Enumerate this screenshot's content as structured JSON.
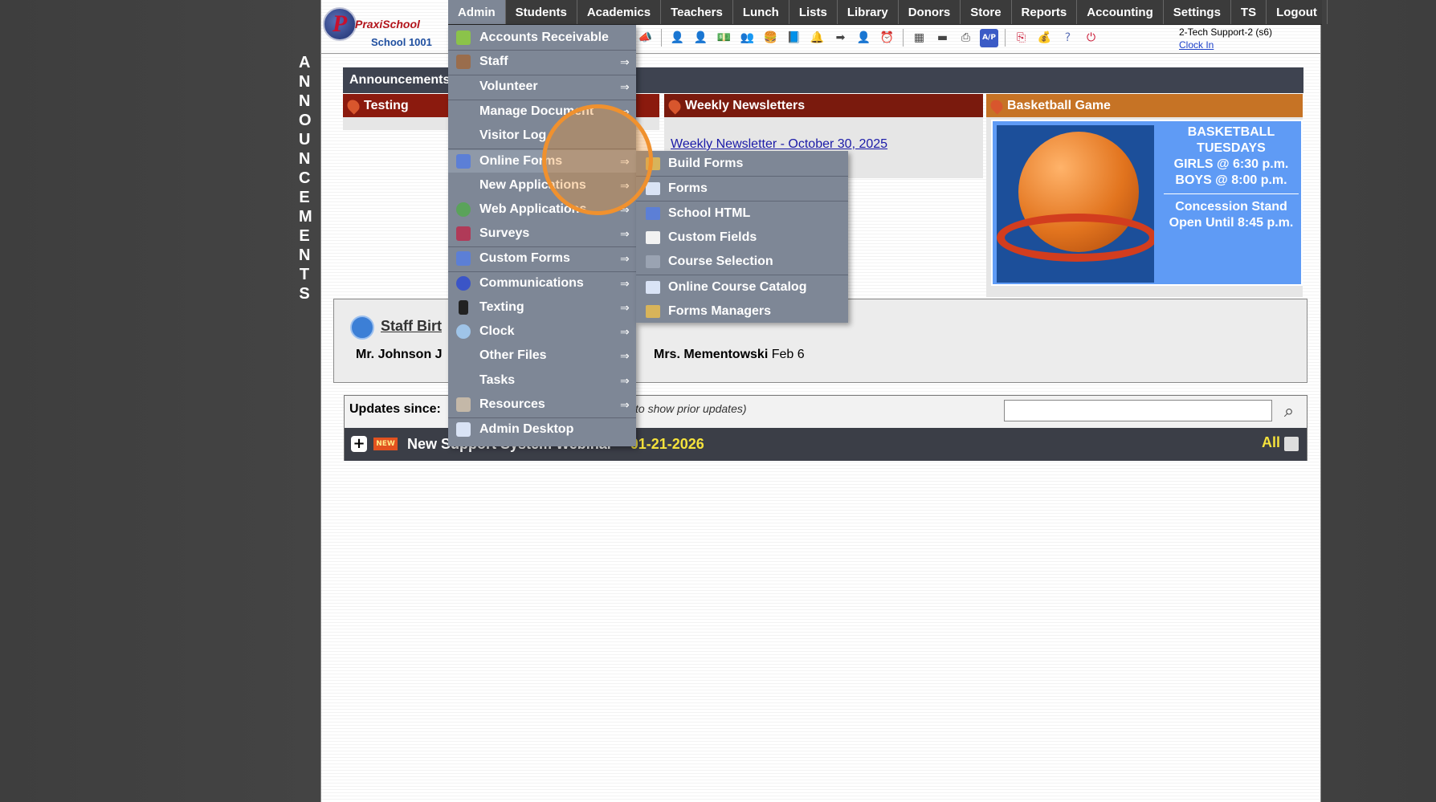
{
  "side_label": [
    "A",
    "N",
    "N",
    "O",
    "U",
    "N",
    "C",
    "E",
    "M",
    "E",
    "N",
    "T",
    "S"
  ],
  "logo": {
    "brand": "PraxiSchool",
    "school": "School 1001"
  },
  "nav": {
    "items": [
      "Admin",
      "Students",
      "Academics",
      "Teachers",
      "Lunch",
      "Lists",
      "Library",
      "Donors",
      "Store",
      "Reports",
      "Accounting",
      "Settings",
      "TS",
      "Logout"
    ],
    "active": "Admin"
  },
  "user": {
    "name": "2-Tech Support-2 (s6)",
    "clock_in": "Clock In"
  },
  "announcements": {
    "title": "Announcements",
    "cards": [
      {
        "title": "Testing"
      },
      {
        "title": "Weekly Newsletters",
        "link": "Weekly Newsletter - October 30, 2025"
      },
      {
        "title": "Basketball Game"
      }
    ],
    "basketball": {
      "line1": "BASKETBALL",
      "line2": "TUESDAYS",
      "line3": "GIRLS @ 6:30 p.m.",
      "line4": "BOYS  @ 8:00 p.m.",
      "line5": "Concession Stand",
      "line6": "Open Until 8:45 p.m."
    }
  },
  "birthdays": {
    "title": "Staff Birt",
    "entry1": "Mr. Johnson J",
    "entry2_name": "Mrs. Mementowski",
    "entry2_date": "Feb 6"
  },
  "updates": {
    "label": "Updates since:",
    "hint": "to show prior updates)",
    "search_placeholder": "",
    "badge": "NEW",
    "headline": "New Support System Webinar --",
    "date": "01-21-2026",
    "all": "All"
  },
  "admin_menu": {
    "items": [
      {
        "label": "Accounts Receivable",
        "arrow": "",
        "icon": "money-icon"
      },
      {
        "label": "Staff",
        "arrow": "⇒",
        "icon": "staff-icon"
      },
      {
        "label": "Volunteer",
        "arrow": "⇒",
        "icon": ""
      },
      {
        "label": "Manage Document",
        "arrow": "⇒",
        "icon": ""
      },
      {
        "label": "Visitor Log",
        "arrow": "",
        "icon": ""
      },
      {
        "label": "Online Forms",
        "arrow": "⇒",
        "icon": "html-icon"
      },
      {
        "label": "New Applications",
        "arrow": "⇒",
        "icon": ""
      },
      {
        "label": "Web Applications",
        "arrow": "⇒",
        "icon": "globe-icon"
      },
      {
        "label": "Surveys",
        "arrow": "⇒",
        "icon": "survey-icon"
      },
      {
        "label": "Custom Forms",
        "arrow": "⇒",
        "icon": "html-icon"
      },
      {
        "label": "Communications",
        "arrow": "⇒",
        "icon": "at-icon"
      },
      {
        "label": "Texting",
        "arrow": "⇒",
        "icon": "phone-icon"
      },
      {
        "label": "Clock",
        "arrow": "⇒",
        "icon": "clock-icon"
      },
      {
        "label": "Other Files",
        "arrow": "⇒",
        "icon": ""
      },
      {
        "label": "Tasks",
        "arrow": "⇒",
        "icon": ""
      },
      {
        "label": "Resources",
        "arrow": "⇒",
        "icon": "resources-icon"
      },
      {
        "label": "Admin Desktop",
        "arrow": "",
        "icon": "desktop-icon"
      }
    ]
  },
  "online_forms_submenu": {
    "items": [
      "Build Forms",
      "Forms",
      "School HTML",
      "Custom Fields",
      "Course Selection",
      "Online Course Catalog",
      "Forms Managers"
    ]
  },
  "colors": {
    "nav_bg": "#3b3b3b",
    "menu_bg": "#7e8796",
    "accent": "#f0912e",
    "testing_head": "#8b1a0e",
    "newsletter_head": "#7a1a0d",
    "basketball_head": "#c67325"
  }
}
